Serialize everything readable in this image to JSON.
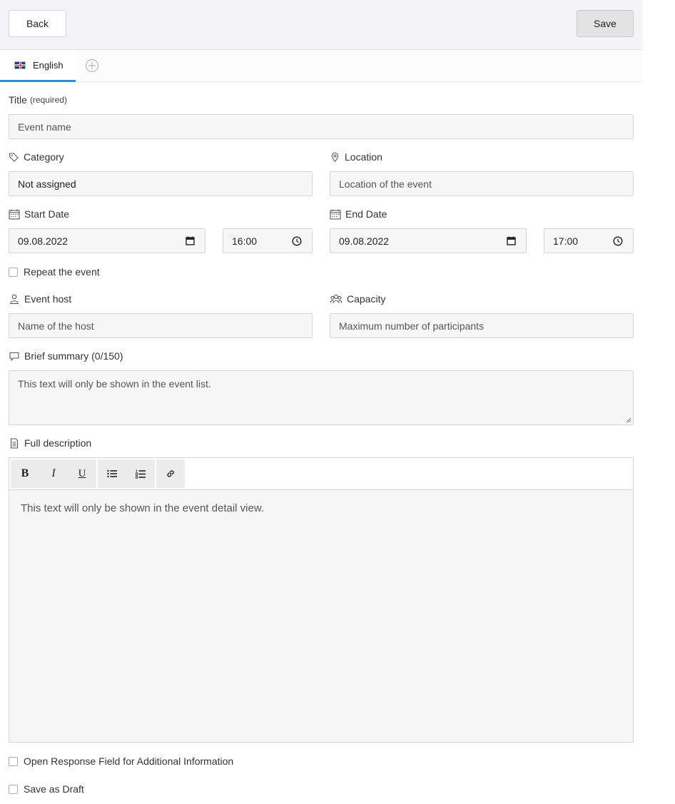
{
  "header": {
    "back_label": "Back",
    "save_label": "Save"
  },
  "tabs": [
    {
      "label": "English",
      "flag": "uk-flag-icon"
    }
  ],
  "title_field": {
    "label": "Title",
    "hint": "(required)",
    "placeholder": "Event name"
  },
  "category": {
    "label": "Category",
    "value": "Not assigned"
  },
  "location": {
    "label": "Location",
    "placeholder": "Location of the event"
  },
  "start": {
    "label": "Start Date",
    "date": "09.08.2022",
    "time": "16:00"
  },
  "end": {
    "label": "End Date",
    "date": "09.08.2022",
    "time": "17:00"
  },
  "repeat": {
    "label": "Repeat the event"
  },
  "host": {
    "label": "Event host",
    "placeholder": "Name of the host"
  },
  "capacity": {
    "label": "Capacity",
    "placeholder": "Maximum number of participants"
  },
  "summary": {
    "label": "Brief summary (0/150)",
    "placeholder": "This text will only be shown in the event list."
  },
  "description": {
    "label": "Full description",
    "toolbar": {
      "bold": "B",
      "italic": "I",
      "underline": "U"
    },
    "placeholder": "This text will only be shown in the event detail view."
  },
  "open_response": {
    "label": "Open Response Field for Additional Information"
  },
  "draft": {
    "label": "Save as Draft"
  },
  "colors": {
    "accent": "#2b8fd6",
    "field_bg": "#f7f7f7",
    "border": "#d5d5d5"
  }
}
